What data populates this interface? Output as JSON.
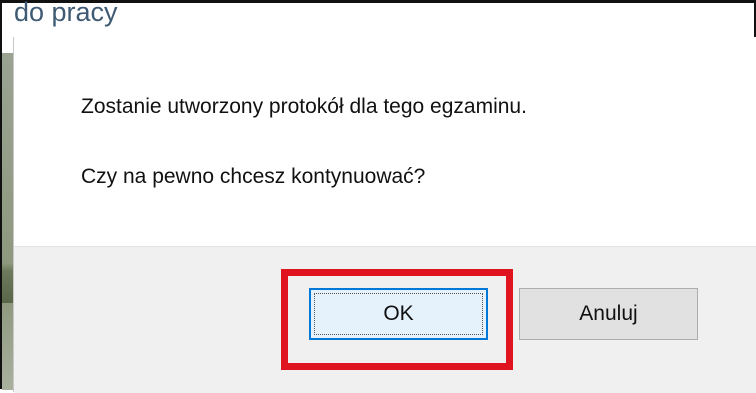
{
  "background": {
    "title_fragment": "do pracy"
  },
  "dialog": {
    "message_line_1": "Zostanie utworzony protokół dla tego egzaminu.",
    "message_line_2": "Czy na pewno chcesz kontynuować?",
    "ok_label": "OK",
    "cancel_label": "Anuluj"
  },
  "colors": {
    "highlight": "#e0141e",
    "focus_border": "#0078d7",
    "button_bar": "#f0f0f0"
  }
}
